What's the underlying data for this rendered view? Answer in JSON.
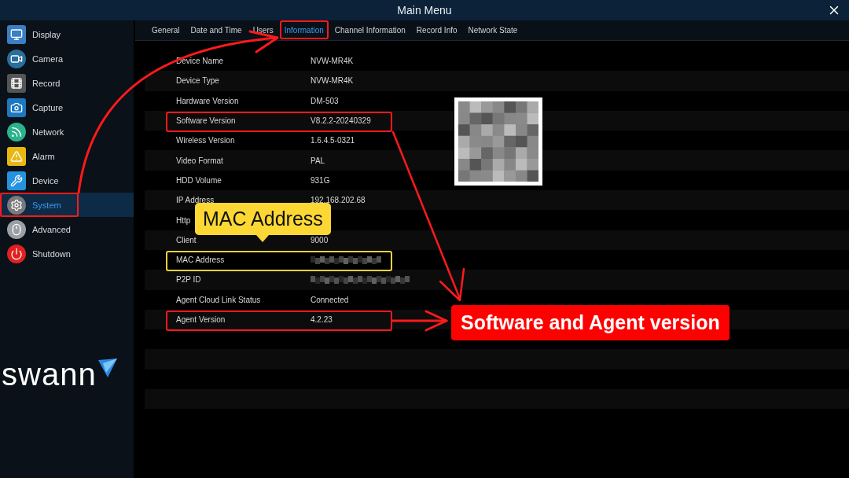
{
  "window": {
    "title": "Main Menu"
  },
  "sidebar": {
    "items": [
      {
        "label": "Display",
        "selected": false,
        "highlighted": false
      },
      {
        "label": "Camera",
        "selected": false,
        "highlighted": false
      },
      {
        "label": "Record",
        "selected": false,
        "highlighted": false
      },
      {
        "label": "Capture",
        "selected": false,
        "highlighted": false
      },
      {
        "label": "Network",
        "selected": false,
        "highlighted": false
      },
      {
        "label": "Alarm",
        "selected": false,
        "highlighted": false
      },
      {
        "label": "Device",
        "selected": false,
        "highlighted": false
      },
      {
        "label": "System",
        "selected": true,
        "highlighted": true
      },
      {
        "label": "Advanced",
        "selected": false,
        "highlighted": false
      },
      {
        "label": "Shutdown",
        "selected": false,
        "highlighted": false
      }
    ],
    "logo": "swann"
  },
  "tabs": [
    {
      "label": "General",
      "selected": false,
      "highlighted": false
    },
    {
      "label": "Date and Time",
      "selected": false,
      "highlighted": false
    },
    {
      "label": "Users",
      "selected": false,
      "highlighted": false
    },
    {
      "label": "Information",
      "selected": true,
      "highlighted": true
    },
    {
      "label": "Channel Information",
      "selected": false,
      "highlighted": false
    },
    {
      "label": "Record Info",
      "selected": false,
      "highlighted": false
    },
    {
      "label": "Network State",
      "selected": false,
      "highlighted": false
    }
  ],
  "info_rows": [
    {
      "kind": "text",
      "label": "Device Name",
      "value": "NVW-MR4K",
      "highlighted": false
    },
    {
      "kind": "text",
      "label": "Device Type",
      "value": "NVW-MR4K",
      "highlighted": false
    },
    {
      "kind": "text",
      "label": "Hardware Version",
      "value": "DM-503",
      "highlighted": false
    },
    {
      "kind": "text",
      "label": "Software Version",
      "value": "V8.2.2-20240329",
      "highlighted": true,
      "color": "#ff1a1a"
    },
    {
      "kind": "text",
      "label": "Wireless Version",
      "value": "1.6.4.5-0321",
      "highlighted": false
    },
    {
      "kind": "text",
      "label": "Video Format",
      "value": "PAL",
      "highlighted": false
    },
    {
      "kind": "text",
      "label": "HDD Volume",
      "value": "931G",
      "highlighted": false
    },
    {
      "kind": "text",
      "label": "IP Address",
      "value": "192.168.202.68",
      "highlighted": false
    },
    {
      "kind": "text",
      "label": "Http",
      "highlighted": false
    },
    {
      "kind": "text",
      "label": "Client",
      "value": "9000",
      "highlighted": false
    },
    {
      "kind": "blurred",
      "label": "MAC Address",
      "highlighted": true,
      "color": "#f5d33a"
    },
    {
      "kind": "blurred",
      "label": "P2P ID",
      "highlighted": false
    },
    {
      "kind": "text",
      "label": "Agent Cloud Link Status",
      "value": "Connected",
      "highlighted": false
    },
    {
      "kind": "text",
      "label": "Agent Version",
      "value": "4.2.23",
      "highlighted": true,
      "color": "#ff1a1a"
    },
    {
      "kind": "empty"
    },
    {
      "kind": "empty"
    },
    {
      "kind": "empty"
    },
    {
      "kind": "empty"
    }
  ],
  "annotations": [
    {
      "kind": "callout",
      "text": "MAC Address",
      "color": "#fdd835"
    },
    {
      "kind": "label",
      "text": "Software and Agent version",
      "color": "#ff0000"
    }
  ]
}
